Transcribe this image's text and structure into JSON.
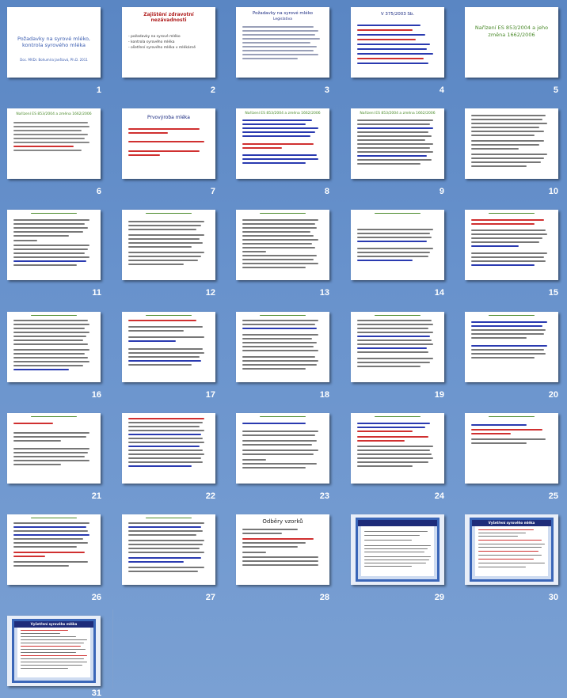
{
  "slides": [
    {
      "n": "1",
      "title": "Požadavky na syrové mléko, kontrola syrového mléka",
      "sub": "Doc. MVDr. Bohumíra Janštová, Ph.D. 2011"
    },
    {
      "n": "2",
      "title": "Zajištění zdravotní nezávadnosti",
      "items": [
        "- požadavky na syrové mléko",
        "- kontrola syrového mléka",
        "- ošetření syrového mléka v mlékárně"
      ]
    },
    {
      "n": "3",
      "title": "Požadavky na syrové mléko",
      "sub": "Legislativa"
    },
    {
      "n": "4",
      "title": "V 375/2003 Sb."
    },
    {
      "n": "5",
      "title": "Nařízení ES 853/2004 a jeho změna 1662/2006"
    },
    {
      "n": "6",
      "title": "Nařízení ES 853/2004 a změna 1662/2006"
    },
    {
      "n": "7",
      "title": "Prvovýroba mléka"
    },
    {
      "n": "8",
      "title": "Nařízení ES 853/2004 a změna 1662/2006"
    },
    {
      "n": "9",
      "title": "Nařízení ES 853/2004 a změna 1662/2006"
    },
    {
      "n": "10",
      "title": ""
    },
    {
      "n": "11",
      "title": ""
    },
    {
      "n": "12",
      "title": ""
    },
    {
      "n": "13",
      "title": ""
    },
    {
      "n": "14",
      "title": ""
    },
    {
      "n": "15",
      "title": ""
    },
    {
      "n": "16",
      "title": ""
    },
    {
      "n": "17",
      "title": ""
    },
    {
      "n": "18",
      "title": ""
    },
    {
      "n": "19",
      "title": ""
    },
    {
      "n": "20",
      "title": ""
    },
    {
      "n": "21",
      "title": ""
    },
    {
      "n": "22",
      "title": ""
    },
    {
      "n": "23",
      "title": ""
    },
    {
      "n": "24",
      "title": ""
    },
    {
      "n": "25",
      "title": ""
    },
    {
      "n": "26",
      "title": ""
    },
    {
      "n": "27",
      "title": ""
    },
    {
      "n": "28",
      "title": "Odběry vzorků"
    },
    {
      "n": "29",
      "title": ""
    },
    {
      "n": "30",
      "title": "Vyšetření syrového mléka"
    },
    {
      "n": "31",
      "title": "Vyšetření syrového mléka"
    }
  ]
}
